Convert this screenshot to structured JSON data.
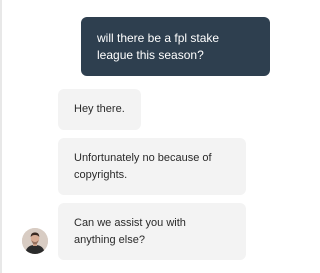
{
  "conversation": {
    "messages": [
      {
        "sender": "user",
        "text": "will there be a fpl stake league this season?"
      },
      {
        "sender": "agent",
        "text": "Hey there."
      },
      {
        "sender": "agent",
        "text": "Unfortunately no because of copyrights."
      },
      {
        "sender": "agent",
        "text": "Can we assist you with anything else?"
      }
    ]
  },
  "colors": {
    "user_bubble": "#2e3f4f",
    "agent_bubble": "#f3f3f3"
  }
}
